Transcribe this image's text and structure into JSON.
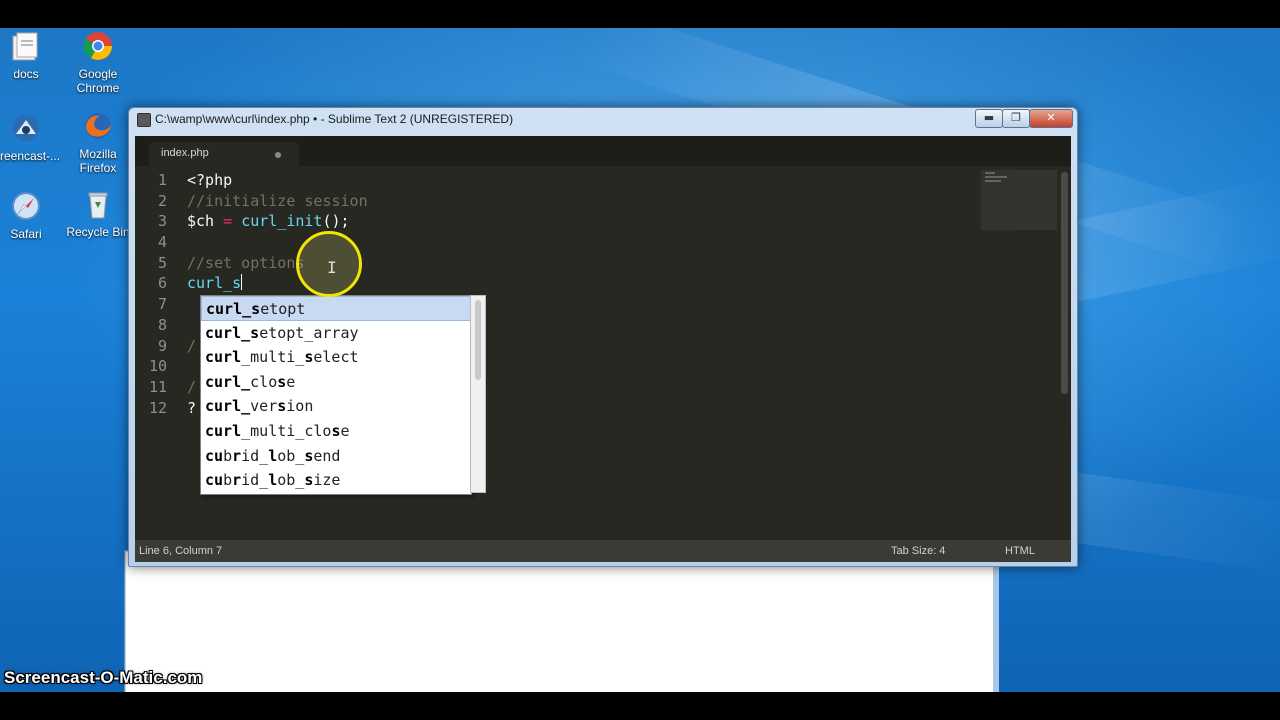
{
  "desktop": {
    "icons": [
      {
        "label": "docs",
        "icon": "folder-icon"
      },
      {
        "label": "Google\nChrome",
        "icon": "chrome-icon"
      },
      {
        "label": "creencast-...",
        "icon": "screencast-icon"
      },
      {
        "label": "Mozilla\nFirefox",
        "icon": "firefox-icon"
      },
      {
        "label": "Safari",
        "icon": "safari-icon"
      },
      {
        "label": "Recycle Bin",
        "icon": "recycle-bin-icon"
      }
    ]
  },
  "window": {
    "title": "C:\\wamp\\www\\curl\\index.php • - Sublime Text 2 (UNREGISTERED)",
    "minimize": "▬",
    "maximize": "❐",
    "close": "✕"
  },
  "editor": {
    "tab_label": "index.php",
    "line_numbers": [
      "1",
      "2",
      "3",
      "4",
      "5",
      "6",
      "7",
      "8",
      "9",
      "10",
      "11",
      "12"
    ],
    "lines": {
      "l1": "<?php",
      "l2": "//initialize session",
      "l3_var": "$ch",
      "l3_op": " = ",
      "l3_fn": "curl_init",
      "l3_end": "();",
      "l5": "//set options",
      "l6": "curl_s",
      "l9": "/",
      "l11": "/",
      "l12": "?"
    }
  },
  "autocomplete": {
    "items": [
      {
        "bold1": "curl_",
        "bold2": "s",
        "rest": "etopt"
      },
      {
        "bold1": "curl_",
        "bold2": "s",
        "rest": "etopt_array"
      },
      {
        "bold1": "curl",
        "mid": "_multi_",
        "bold2": "s",
        "rest": "elect"
      },
      {
        "bold1": "curl_",
        "mid": "clo",
        "bold2": "s",
        "rest": "e"
      },
      {
        "bold1": "curl_",
        "mid": "ver",
        "bold2": "s",
        "rest": "ion"
      },
      {
        "bold1": "curl",
        "mid": "_multi_clo",
        "bold2": "s",
        "rest": "e"
      },
      {
        "bold1": "cu",
        "mid": "b",
        "bold2": "r",
        "rest": "id_",
        "bold3": "l",
        "rest2": "ob_",
        "bold4": "s",
        "rest3": "end"
      },
      {
        "bold1": "cu",
        "mid": "b",
        "bold2": "r",
        "rest": "id_",
        "bold3": "l",
        "rest2": "ob_",
        "bold4": "s",
        "rest3": "ize"
      }
    ]
  },
  "status": {
    "position": "Line 6, Column 7",
    "tab_size": "Tab Size: 4",
    "syntax": "HTML"
  },
  "watermark": "Screencast-O-Matic.com"
}
